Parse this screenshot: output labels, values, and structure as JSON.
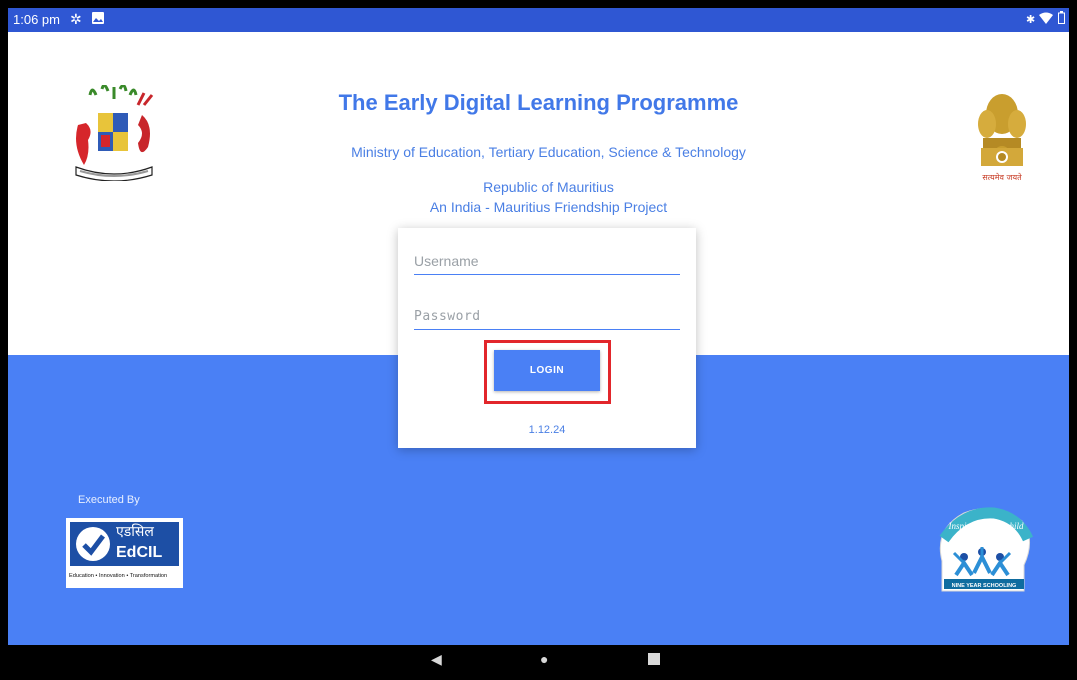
{
  "status_bar": {
    "time": "1:06 pm",
    "icons": [
      "settings-icon",
      "image-icon",
      "bluetooth-icon",
      "wifi-icon",
      "battery-icon"
    ]
  },
  "header": {
    "title": "The Early Digital Learning Programme",
    "ministry": "Ministry of Education, Tertiary Education, Science & Technology",
    "republic": "Republic of Mauritius",
    "project": "An India - Mauritius Friendship Project"
  },
  "login_form": {
    "username_placeholder": "Username",
    "password_placeholder": "Password",
    "login_label": "LOGIN",
    "version": "1.12.24"
  },
  "footer": {
    "executed_by": "Executed By",
    "edcil_name": "EdCIL",
    "edcil_hindi": "एडसिल",
    "edcil_tagline": "Education • Innovation • Transformation",
    "nys_motto": "Inspiring every child",
    "nys_label": "NINE YEAR SCHOOLING"
  },
  "emblem_caption": "सत्यमेव जयते",
  "nav_bar": [
    "back-icon",
    "home-icon",
    "recents-icon"
  ],
  "colors": {
    "accent": "#4a80f5",
    "status_bar": "#2f57d3",
    "title": "#4178e8",
    "highlight": "#e2262b"
  }
}
